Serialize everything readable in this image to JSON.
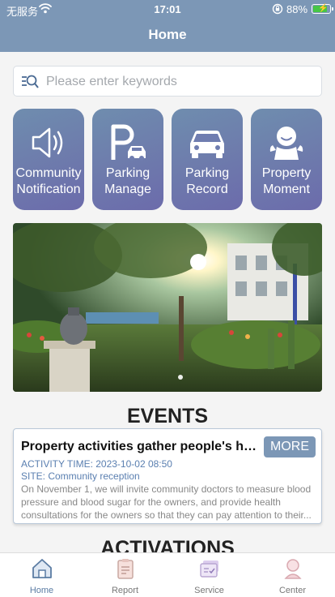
{
  "status_bar": {
    "carrier": "无服务",
    "time": "17:01",
    "battery": "88%",
    "battery_level": 0.88
  },
  "header": {
    "title": "Home"
  },
  "search": {
    "placeholder": "Please enter keywords"
  },
  "quick_actions": [
    {
      "label": "Community Notification",
      "icon": "speaker-icon"
    },
    {
      "label": "Parking Manage",
      "icon": "parking-icon"
    },
    {
      "label": "Parking Record",
      "icon": "car-icon"
    },
    {
      "label": "Property Moment",
      "icon": "person-icon"
    }
  ],
  "banner": {
    "image": "garden-photo"
  },
  "events": {
    "heading": "EVENTS",
    "more_label": "MORE",
    "item": {
      "title": "Property activities gather people's he...",
      "time": "ACTIVITY TIME: 2023-10-02 08:50",
      "site": "SITE: Community reception",
      "description": "On November 1, we will invite community doctors to measure blood pressure and blood sugar for the owners, and provide health consultations for the owners so that they can pay attention to their..."
    }
  },
  "activations": {
    "heading": "ACTIVATIONS"
  },
  "tabbar": [
    {
      "label": "Home",
      "icon": "home-icon",
      "active": true
    },
    {
      "label": "Report",
      "icon": "clipboard-icon",
      "active": false
    },
    {
      "label": "Service",
      "icon": "service-icon",
      "active": false
    },
    {
      "label": "Center",
      "icon": "user-center-icon",
      "active": false
    }
  ],
  "colors": {
    "header": "#7c97b6",
    "accent": "#5a7fb0",
    "tile_gradient_start": "#6f8dae",
    "tile_gradient_end": "#6c6bab"
  }
}
